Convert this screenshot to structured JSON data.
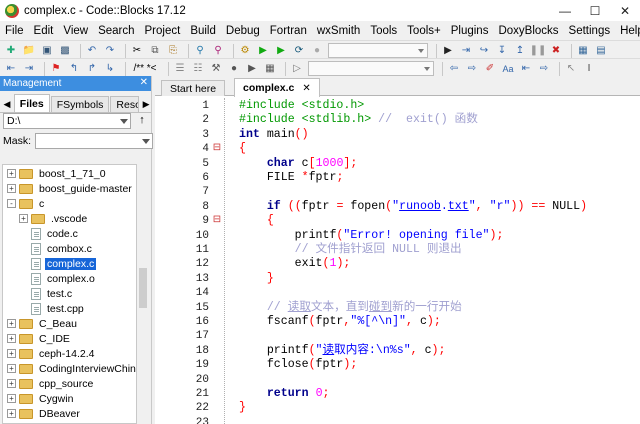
{
  "window": {
    "title": "complex.c - Code::Blocks 17.12",
    "controls": [
      "minimize",
      "maximize",
      "close"
    ]
  },
  "menu": [
    "File",
    "Edit",
    "View",
    "Search",
    "Project",
    "Build",
    "Debug",
    "Fortran",
    "wxSmith",
    "Tools",
    "Tools+",
    "Plugins",
    "DoxyBlocks",
    "Settings",
    "Help"
  ],
  "toolbar2": {
    "doxy_label": "/** *<"
  },
  "management": {
    "title": "Management",
    "tabs": [
      "Files",
      "FSymbols",
      "Resources"
    ],
    "path": "D:\\",
    "mask_label": "Mask:",
    "tree": [
      {
        "label": "boost_1_71_0",
        "type": "folder",
        "indent": 0,
        "state": "+"
      },
      {
        "label": "boost_guide-master",
        "type": "folder",
        "indent": 0,
        "state": "+"
      },
      {
        "label": "c",
        "type": "folder",
        "indent": 0,
        "state": "-"
      },
      {
        "label": ".vscode",
        "type": "folder",
        "indent": 1,
        "state": "+"
      },
      {
        "label": "code.c",
        "type": "file",
        "indent": 1
      },
      {
        "label": "combox.c",
        "type": "file",
        "indent": 1
      },
      {
        "label": "complex.c",
        "type": "file",
        "indent": 1,
        "selected": true
      },
      {
        "label": "complex.o",
        "type": "file",
        "indent": 1
      },
      {
        "label": "test.c",
        "type": "file",
        "indent": 1
      },
      {
        "label": "test.cpp",
        "type": "file",
        "indent": 1
      },
      {
        "label": "C_Beau",
        "type": "folder",
        "indent": 0,
        "state": "+"
      },
      {
        "label": "C_IDE",
        "type": "folder",
        "indent": 0,
        "state": "+"
      },
      {
        "label": "ceph-14.2.4",
        "type": "folder",
        "indent": 0,
        "state": "+"
      },
      {
        "label": "CodingInterviewChines",
        "type": "folder",
        "indent": 0,
        "state": "+"
      },
      {
        "label": "cpp_source",
        "type": "folder",
        "indent": 0,
        "state": "+"
      },
      {
        "label": "Cygwin",
        "type": "folder",
        "indent": 0,
        "state": "+"
      },
      {
        "label": "DBeaver",
        "type": "folder",
        "indent": 0,
        "state": "+"
      }
    ]
  },
  "editor": {
    "tabs": [
      {
        "label": "Start here",
        "active": false
      },
      {
        "label": "complex.c",
        "active": true,
        "closable": true
      }
    ],
    "lines": [
      {
        "n": "1",
        "fold": "",
        "code": [
          {
            "c": "pre",
            "t": "#include <stdio.h>"
          }
        ]
      },
      {
        "n": "2",
        "fold": "",
        "code": [
          {
            "c": "pre",
            "t": "#include <stdlib.h> "
          },
          {
            "c": "cm",
            "t": "//  exit() 函数"
          }
        ]
      },
      {
        "n": "3",
        "fold": "",
        "code": [
          {
            "c": "kw",
            "t": "int"
          },
          {
            "c": "",
            "t": " main"
          },
          {
            "c": "op",
            "t": "()"
          }
        ]
      },
      {
        "n": "4",
        "fold": "⊟",
        "code": [
          {
            "c": "op",
            "t": "{"
          }
        ]
      },
      {
        "n": "5",
        "fold": "",
        "code": [
          {
            "c": "",
            "t": "    "
          },
          {
            "c": "kw",
            "t": "char"
          },
          {
            "c": "",
            "t": " c"
          },
          {
            "c": "op",
            "t": "["
          },
          {
            "c": "num",
            "t": "1000"
          },
          {
            "c": "op",
            "t": "];"
          }
        ]
      },
      {
        "n": "6",
        "fold": "",
        "code": [
          {
            "c": "",
            "t": "    FILE "
          },
          {
            "c": "op",
            "t": "*"
          },
          {
            "c": "",
            "t": "fptr"
          },
          {
            "c": "op",
            "t": ";"
          }
        ]
      },
      {
        "n": "7",
        "fold": "",
        "code": []
      },
      {
        "n": "8",
        "fold": "",
        "code": [
          {
            "c": "",
            "t": "    "
          },
          {
            "c": "kw",
            "t": "if"
          },
          {
            "c": "",
            "t": " "
          },
          {
            "c": "op",
            "t": "(("
          },
          {
            "c": "",
            "t": "fptr "
          },
          {
            "c": "op",
            "t": "="
          },
          {
            "c": "",
            "t": " fopen"
          },
          {
            "c": "op",
            "t": "("
          },
          {
            "c": "str",
            "t": "\""
          },
          {
            "c": "str u",
            "t": "runoob"
          },
          {
            "c": "str",
            "t": "."
          },
          {
            "c": "str u",
            "t": "txt"
          },
          {
            "c": "str",
            "t": "\""
          },
          {
            "c": "op",
            "t": ","
          },
          {
            "c": "",
            "t": " "
          },
          {
            "c": "str",
            "t": "\"r\""
          },
          {
            "c": "op",
            "t": "))"
          },
          {
            "c": "",
            "t": " "
          },
          {
            "c": "op",
            "t": "=="
          },
          {
            "c": "",
            "t": " NULL"
          },
          {
            "c": "op",
            "t": ")"
          }
        ]
      },
      {
        "n": "9",
        "fold": "⊟",
        "code": [
          {
            "c": "",
            "t": "    "
          },
          {
            "c": "op",
            "t": "{"
          }
        ]
      },
      {
        "n": "10",
        "fold": "",
        "code": [
          {
            "c": "",
            "t": "        printf"
          },
          {
            "c": "op",
            "t": "("
          },
          {
            "c": "str",
            "t": "\"Error! opening file\""
          },
          {
            "c": "op",
            "t": ");"
          }
        ]
      },
      {
        "n": "11",
        "fold": "",
        "code": [
          {
            "c": "",
            "t": "        "
          },
          {
            "c": "cm",
            "t": "// 文件指针返回 NULL 则退出"
          }
        ]
      },
      {
        "n": "12",
        "fold": "",
        "code": [
          {
            "c": "",
            "t": "        exit"
          },
          {
            "c": "op",
            "t": "("
          },
          {
            "c": "num",
            "t": "1"
          },
          {
            "c": "op",
            "t": ");"
          }
        ]
      },
      {
        "n": "13",
        "fold": "",
        "code": [
          {
            "c": "",
            "t": "    "
          },
          {
            "c": "op",
            "t": "}"
          }
        ]
      },
      {
        "n": "14",
        "fold": "",
        "code": []
      },
      {
        "n": "15",
        "fold": "",
        "code": [
          {
            "c": "",
            "t": "    "
          },
          {
            "c": "cm",
            "t": "// "
          },
          {
            "c": "cm u",
            "t": "读取"
          },
          {
            "c": "cm",
            "t": "文本，直到"
          },
          {
            "c": "cm u",
            "t": "碰到"
          },
          {
            "c": "cm",
            "t": "新的一行开始"
          }
        ]
      },
      {
        "n": "16",
        "fold": "",
        "code": [
          {
            "c": "",
            "t": "    fscanf"
          },
          {
            "c": "op",
            "t": "("
          },
          {
            "c": "",
            "t": "fptr"
          },
          {
            "c": "op",
            "t": ","
          },
          {
            "c": "str",
            "t": "\"%[^\\n]\""
          },
          {
            "c": "op",
            "t": ","
          },
          {
            "c": "",
            "t": " c"
          },
          {
            "c": "op",
            "t": ");"
          }
        ]
      },
      {
        "n": "17",
        "fold": "",
        "code": []
      },
      {
        "n": "18",
        "fold": "",
        "code": [
          {
            "c": "",
            "t": "    printf"
          },
          {
            "c": "op",
            "t": "("
          },
          {
            "c": "str",
            "t": "\""
          },
          {
            "c": "str u",
            "t": "读"
          },
          {
            "c": "str",
            "t": "取内容:\\n%s\""
          },
          {
            "c": "op",
            "t": ","
          },
          {
            "c": "",
            "t": " c"
          },
          {
            "c": "op",
            "t": ");"
          }
        ]
      },
      {
        "n": "19",
        "fold": "",
        "code": [
          {
            "c": "",
            "t": "    fclose"
          },
          {
            "c": "op",
            "t": "("
          },
          {
            "c": "",
            "t": "fptr"
          },
          {
            "c": "op",
            "t": ");"
          }
        ]
      },
      {
        "n": "20",
        "fold": "",
        "code": []
      },
      {
        "n": "21",
        "fold": "",
        "code": [
          {
            "c": "",
            "t": "    "
          },
          {
            "c": "kw",
            "t": "return"
          },
          {
            "c": "",
            "t": " "
          },
          {
            "c": "num",
            "t": "0"
          },
          {
            "c": "op",
            "t": ";"
          }
        ]
      },
      {
        "n": "22",
        "fold": "",
        "code": [
          {
            "c": "op",
            "t": "}"
          }
        ]
      },
      {
        "n": "23",
        "fold": "",
        "code": []
      }
    ]
  }
}
